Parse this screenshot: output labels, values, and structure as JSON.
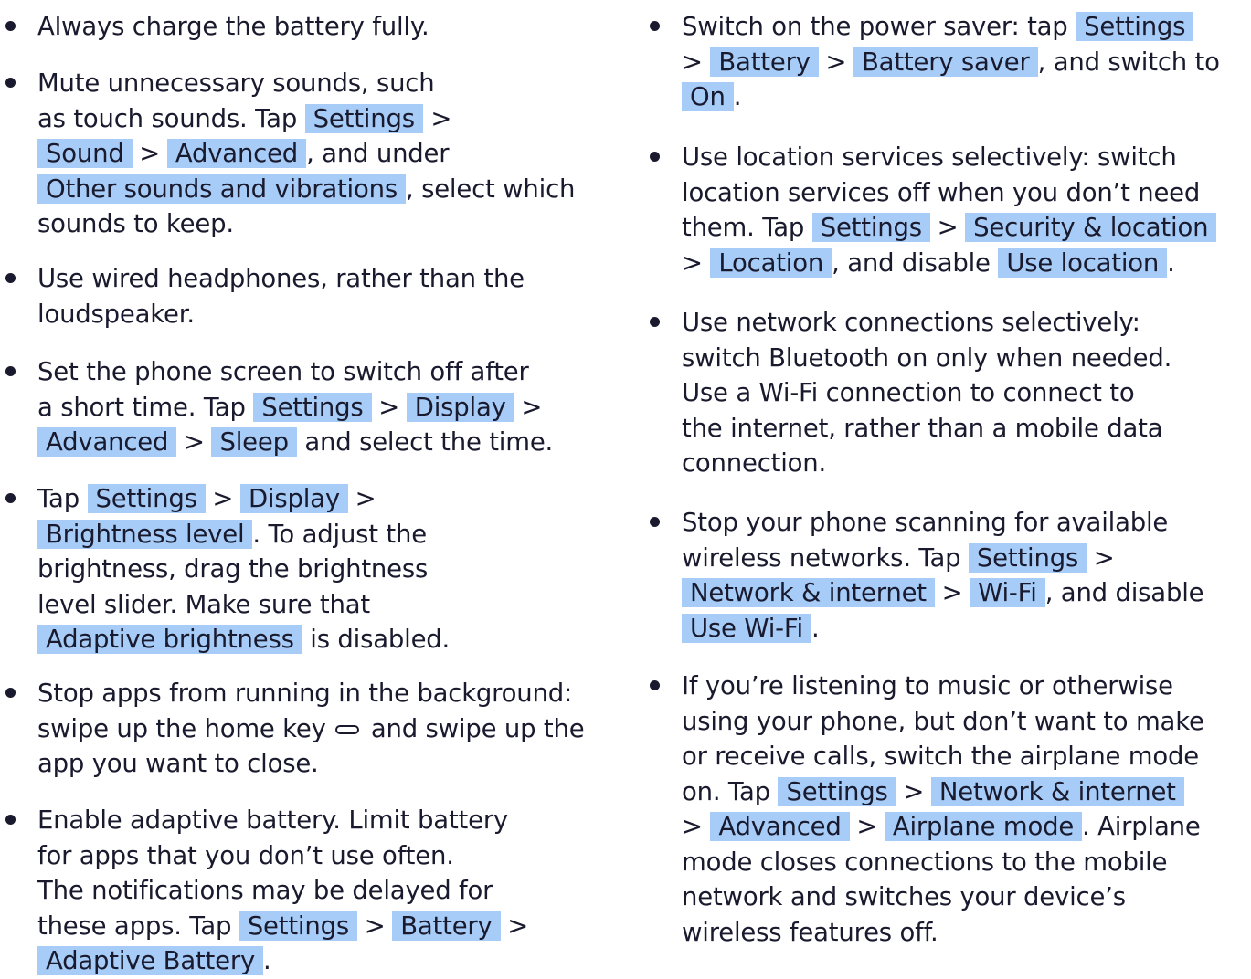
{
  "left_column": {
    "tip1": {
      "l1": "Always charge the battery fully."
    },
    "tip2": {
      "l1": "Mute unnecessary sounds, such",
      "l2_a": "as touch sounds. Tap",
      "settings": "Settings",
      "sep": ">",
      "sound": "Sound",
      "advanced": "Advanced",
      "l3_b": ", and under",
      "other_sounds": "Other sounds and vibrations",
      "l4_b": ", select which",
      "l5": "sounds to keep."
    },
    "tip3": {
      "l1": "Use wired headphones, rather than the",
      "l2": "loudspeaker."
    },
    "tip4": {
      "l1": "Set the phone screen to switch off after",
      "l2_a": "a short time. Tap",
      "settings": "Settings",
      "sep": ">",
      "display": "Display",
      "advanced": "Advanced",
      "sleep": "Sleep",
      "l3_b": "and select the time."
    },
    "tip5": {
      "l1_a": "Tap",
      "settings": "Settings",
      "sep": ">",
      "display": "Display",
      "brightness_level": "Brightness level",
      "l2_b": ". To adjust the",
      "l3": "brightness, drag the brightness",
      "l4": "level slider. Make sure that",
      "adaptive_brightness": "Adaptive brightness",
      "l5_b": "is disabled."
    },
    "tip6": {
      "l1": "Stop apps from running in the background:",
      "l2_a": "swipe up the home key",
      "l2_b": "and swipe up the",
      "l3": "app you want to close."
    },
    "tip7": {
      "l1": "Enable adaptive battery. Limit battery",
      "l2": "for apps that you don’t use often.",
      "l3": "The notifications may be delayed for",
      "l4_a": "these apps. Tap",
      "settings": "Settings",
      "sep": ">",
      "battery": "Battery",
      "adaptive_battery": "Adaptive Battery",
      "end": "."
    }
  },
  "right_column": {
    "tip8": {
      "l1_a": "Switch on the power saver: tap",
      "settings": "Settings",
      "sep": ">",
      "battery": "Battery",
      "battery_saver": "Battery saver",
      "l2_b": ", and switch to",
      "on": "On",
      "end": "."
    },
    "tip9": {
      "l1": "Use location services selectively: switch",
      "l2": "location services off when you don’t need",
      "l3_a": "them. Tap",
      "settings": "Settings",
      "sep": ">",
      "security_location": "Security & location",
      "location": "Location",
      "l4_b": ", and disable",
      "use_location": "Use location",
      "end": "."
    },
    "tip10": {
      "l1": "Use network connections selectively:",
      "l2": "switch Bluetooth on only when needed.",
      "l3": "Use a Wi-Fi connection to connect to",
      "l4": "the internet, rather than a mobile data",
      "l5": "connection."
    },
    "tip11": {
      "l1": "Stop your phone scanning for available",
      "l2_a": "wireless networks. Tap",
      "settings": "Settings",
      "sep": ">",
      "network_internet": "Network & internet",
      "wifi": "Wi-Fi",
      "l3_b": ", and disable",
      "use_wifi": "Use Wi-Fi",
      "end": "."
    },
    "tip12": {
      "l1": "If you’re listening to music or otherwise",
      "l2": "using your phone, but don’t want to make",
      "l3": "or receive calls, switch the airplane mode",
      "l4_a": "on. Tap",
      "settings": "Settings",
      "sep": ">",
      "network_internet": "Network & internet",
      "advanced": "Advanced",
      "airplane_mode": "Airplane mode",
      "l5_b": ". Airplane",
      "l6": "mode closes connections to the mobile",
      "l7": "network and switches your device’s",
      "l8": "wireless features off."
    }
  },
  "colors": {
    "ui_highlight": "#a6ccf7",
    "text": "#1a1a2e",
    "background": "#ffffff"
  },
  "icons": [
    "bullet-icon",
    "home-key-icon"
  ]
}
